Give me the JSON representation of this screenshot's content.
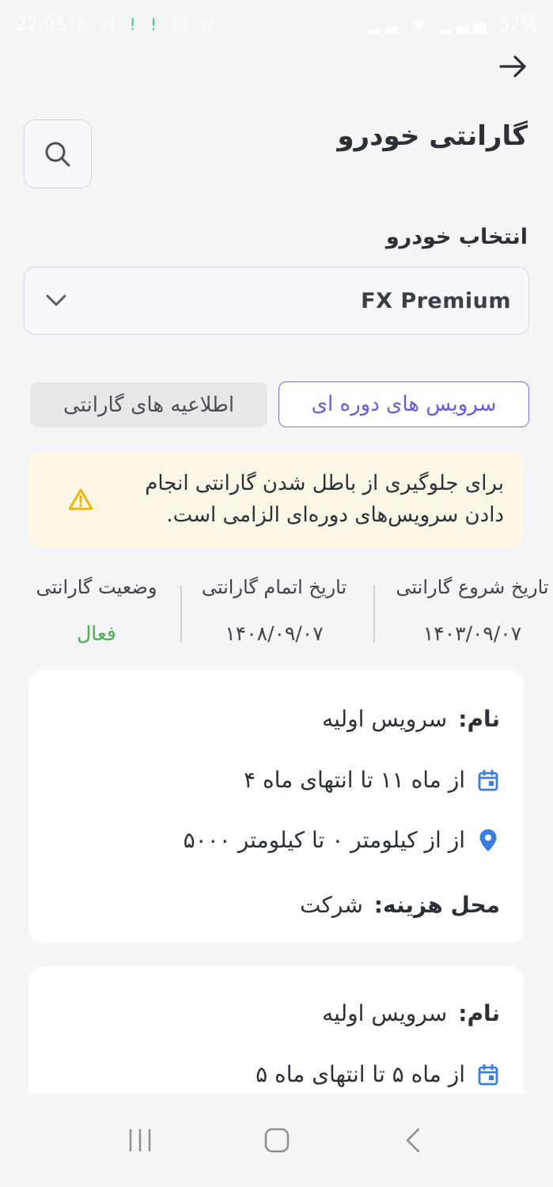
{
  "status_bar": {
    "time": "22:05",
    "battery": "37%",
    "extra": "۲۲"
  },
  "header": {
    "title": "گارانتی خودرو"
  },
  "vehicle_select": {
    "label": "انتخاب خودرو",
    "value": "FX Premium"
  },
  "tabs": [
    {
      "label": "سرویس های دوره ای",
      "active": true
    },
    {
      "label": "اطلاعیه های گارانتی",
      "active": false
    }
  ],
  "warning": {
    "text": "برای جلوگیری از باطل شدن گارانتی انجام دادن سرویس‌های دوره‌ای الزامی است."
  },
  "warranty_info": {
    "start_label": "تاریخ شروع گارانتی",
    "start_value": "۱۴۰۳/۰۹/۰۷",
    "end_label": "تاریخ اتمام گارانتی",
    "end_value": "۱۴۰۸/۰۹/۰۷",
    "status_label": "وضعیت گارانتی",
    "status_value": "فعال"
  },
  "services": [
    {
      "name_key": "نام:",
      "name_value": "سرویس اولیه",
      "month_range": "از ماه ۱۱ تا انتهای ماه ۴",
      "km_range": "از از کیلومتر ۰ تا کیلومتر ۵۰۰۰",
      "cost_key": "محل هزینه:",
      "cost_value": "شرکت"
    },
    {
      "name_key": "نام:",
      "name_value": "سرویس اولیه",
      "month_range": "از ماه ۵ تا انتهای ماه ۵"
    }
  ],
  "colors": {
    "accent": "#6a5ad6",
    "active_status": "#4caf50",
    "warning_bg": "#fbf6e6",
    "warning_icon": "#f0b400",
    "icon_blue": "#3b7ddd"
  }
}
